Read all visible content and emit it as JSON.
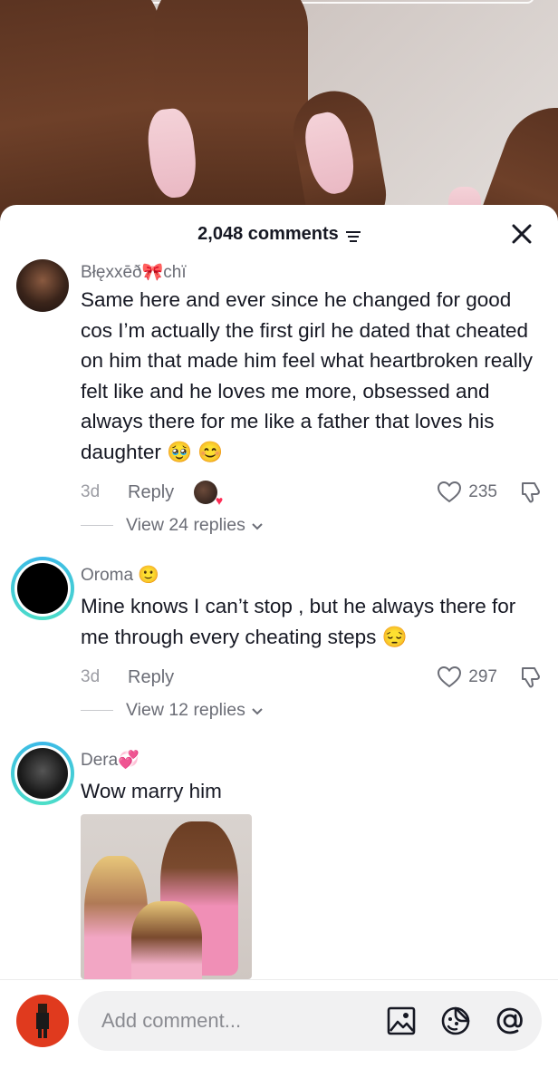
{
  "header": {
    "comment_count": "2,048 comments"
  },
  "comments": [
    {
      "username": "Błęxxēð🎀chï",
      "text": "Same here and ever since he changed for good cos I’m actually the first girl he dated that cheated on him that made him feel what heartbroken really felt like and he loves me more, obsessed and always there for me like a father that loves his daughter 🥹 😊",
      "time": "3d",
      "reply_label": "Reply",
      "likes": "235",
      "view_replies": "View 24 replies"
    },
    {
      "username": "Oroma 🙂",
      "text": "Mine knows I can’t stop , but he always there for me through every cheating steps 😔",
      "time": "3d",
      "reply_label": "Reply",
      "likes": "297",
      "view_replies": "View 12 replies"
    },
    {
      "username": "Dera💞",
      "text": "Wow marry him"
    }
  ],
  "composer": {
    "placeholder": "Add comment..."
  },
  "icons": {
    "filter": "filter-icon",
    "close": "close-icon",
    "heart": "heart-icon",
    "dislike": "dislike-icon",
    "chevron": "chevron-down-icon",
    "image": "image-icon",
    "emoji": "emoji-icon",
    "mention": "at-icon"
  },
  "colors": {
    "accent_ring": "#3bb8e8",
    "like_heart": "#fe2c55"
  }
}
